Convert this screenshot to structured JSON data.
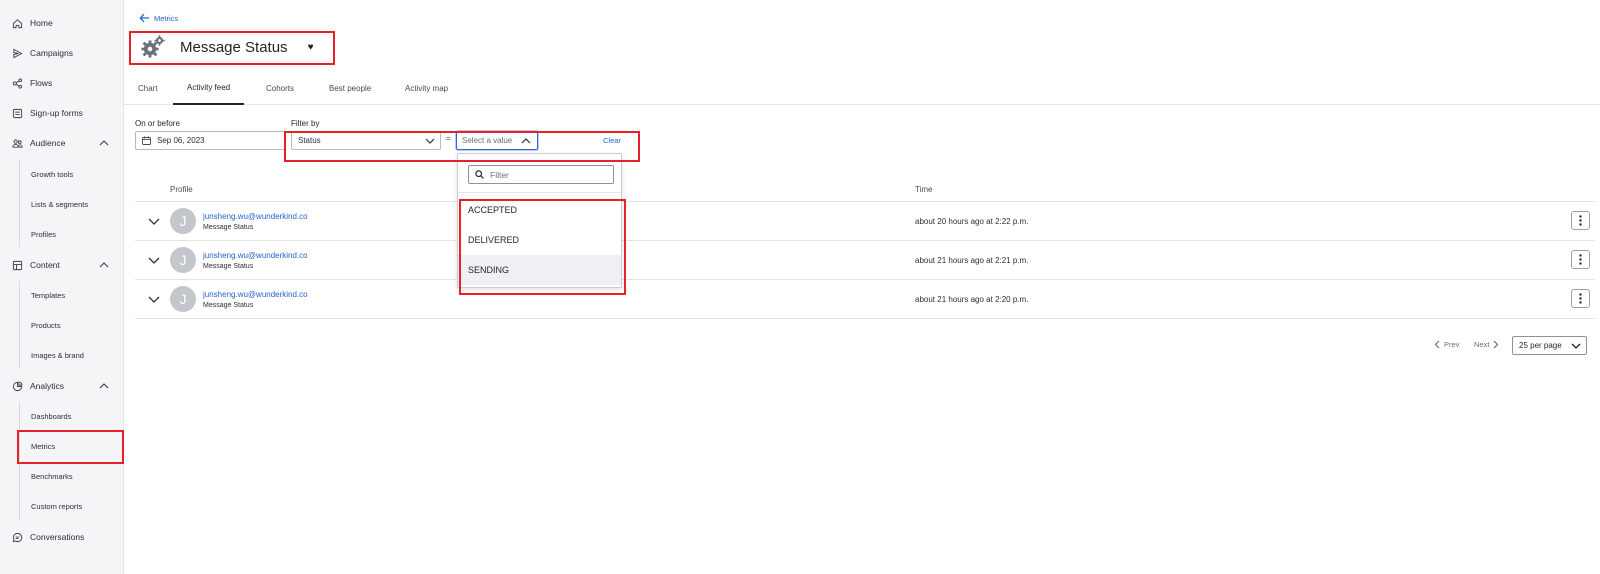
{
  "sidebar": {
    "items": [
      {
        "label": "Home",
        "icon": "home-icon"
      },
      {
        "label": "Campaigns",
        "icon": "send-icon"
      },
      {
        "label": "Flows",
        "icon": "flows-icon"
      },
      {
        "label": "Sign-up forms",
        "icon": "form-icon"
      },
      {
        "label": "Audience",
        "icon": "people-icon"
      },
      {
        "label": "Content",
        "icon": "content-icon"
      },
      {
        "label": "Analytics",
        "icon": "analytics-icon"
      },
      {
        "label": "Conversations",
        "icon": "chat-icon"
      }
    ],
    "audience_sub": [
      "Growth tools",
      "Lists & segments",
      "Profiles"
    ],
    "content_sub": [
      "Templates",
      "Products",
      "Images & brand"
    ],
    "analytics_sub": [
      "Dashboards",
      "Metrics",
      "Benchmarks",
      "Custom reports"
    ],
    "active_item": "Metrics"
  },
  "header": {
    "back_label": "Metrics",
    "title": "Message Status",
    "caret": "♥"
  },
  "tabs": [
    "Chart",
    "Activity feed",
    "Cohorts",
    "Best people",
    "Activity map"
  ],
  "active_tab": "Activity feed",
  "filters": {
    "date_label": "On or before",
    "date_value": "Sep 06, 2023",
    "filter_label": "Filter by",
    "field_value": "Status",
    "operator": "=",
    "value_placeholder": "Select a value",
    "clear_label": "Clear",
    "dropdown": {
      "search_placeholder": "Filter",
      "options": [
        "ACCEPTED",
        "DELIVERED",
        "SENDING"
      ],
      "hovered_option": "SENDING"
    }
  },
  "table": {
    "columns": {
      "profile": "Profile",
      "time": "Time"
    },
    "rows": [
      {
        "avatar": "J",
        "email": "junsheng.wu@wunderkind.co",
        "event": "Message Status",
        "time": "about 20 hours ago at 2:22 p.m."
      },
      {
        "avatar": "J",
        "email": "junsheng.wu@wunderkind.co",
        "event": "Message Status",
        "time": "about 21 hours ago at 2:21 p.m."
      },
      {
        "avatar": "J",
        "email": "junsheng.wu@wunderkind.co",
        "event": "Message Status",
        "time": "about 21 hours ago at 2:20 p.m."
      }
    ]
  },
  "pagination": {
    "prev": "Prev",
    "next": "Next",
    "per_page": "25 per page"
  },
  "colors": {
    "accent": "#2563c9",
    "annotation": "#e8202a",
    "sidebar_bg": "#f4f5f7"
  }
}
